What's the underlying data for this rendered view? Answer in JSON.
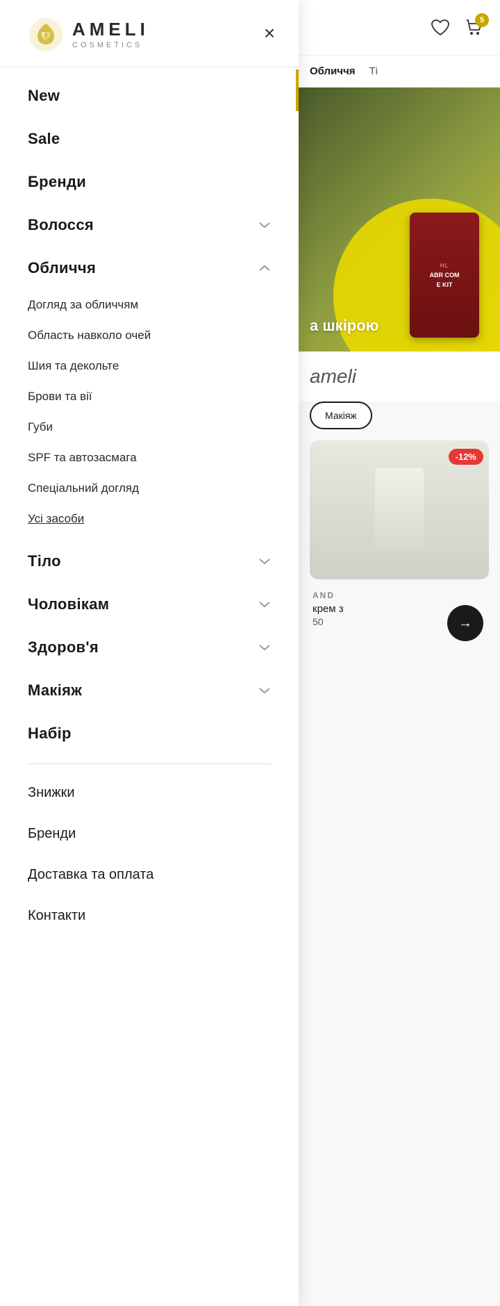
{
  "header": {
    "wishlist_count": "",
    "cart_count": "5"
  },
  "logo": {
    "name": "AMELI",
    "subtitle": "COSMETICS"
  },
  "nav": {
    "close_label": "×",
    "items": [
      {
        "id": "new",
        "label": "New",
        "has_submenu": false,
        "expanded": false
      },
      {
        "id": "sale",
        "label": "Sale",
        "has_submenu": false,
        "expanded": false
      },
      {
        "id": "brands",
        "label": "Бренди",
        "has_submenu": false,
        "expanded": false
      },
      {
        "id": "hair",
        "label": "Волосся",
        "has_submenu": true,
        "expanded": false
      },
      {
        "id": "face",
        "label": "Обличчя",
        "has_submenu": true,
        "expanded": true
      }
    ],
    "face_submenu": [
      {
        "label": "Догляд за обличчям",
        "underlined": false
      },
      {
        "label": "Область навколо очей",
        "underlined": false
      },
      {
        "label": "Шия та декольте",
        "underlined": false
      },
      {
        "label": "Брови та вії",
        "underlined": false
      },
      {
        "label": "Губи",
        "underlined": false
      },
      {
        "label": "SPF та автозасмага",
        "underlined": false
      },
      {
        "label": "Спеціальний догляд",
        "underlined": false
      },
      {
        "label": "Усі засоби",
        "underlined": true
      }
    ],
    "more_items": [
      {
        "id": "body",
        "label": "Тіло",
        "has_submenu": true
      },
      {
        "id": "men",
        "label": "Чоловікам",
        "has_submenu": true
      },
      {
        "id": "health",
        "label": "Здоров'я",
        "has_submenu": true
      },
      {
        "id": "makeup",
        "label": "Макіяж",
        "has_submenu": true
      },
      {
        "id": "set",
        "label": "Набір",
        "has_submenu": false
      }
    ],
    "footer_items": [
      {
        "id": "discounts",
        "label": "Знижки"
      },
      {
        "id": "brands2",
        "label": "Бренди"
      },
      {
        "id": "delivery",
        "label": "Доставка та оплата"
      },
      {
        "id": "contacts",
        "label": "Контакти"
      }
    ]
  },
  "right_tabs": [
    {
      "label": "Обличчя",
      "active": true
    },
    {
      "label": "Ті",
      "active": false
    }
  ],
  "hero": {
    "text": "а шкірою",
    "product_label": "HL",
    "product_name": "ABR COM",
    "product_sub": "E KIT"
  },
  "brand_section": {
    "logo_text": "ameli"
  },
  "category_buttons": [
    {
      "label": "Макіяж",
      "active": true
    }
  ],
  "product_card": {
    "discount": "-12%",
    "brand": "AND",
    "name": "крем з",
    "price": "50"
  },
  "icons": {
    "heart": "♡",
    "cart": "🛍",
    "chevron_down": "∨",
    "chevron_up": "∧",
    "close": "×",
    "arrow_right": "→"
  }
}
